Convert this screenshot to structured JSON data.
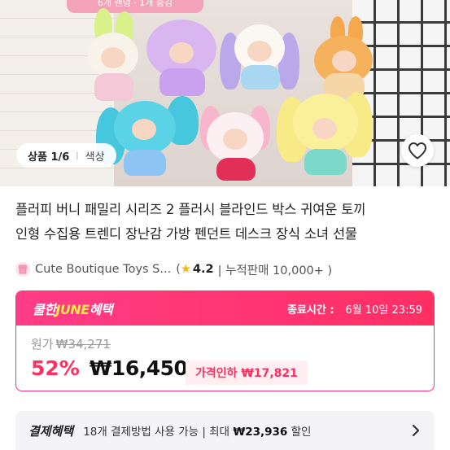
{
  "hero": {
    "banner_text": "6개 랜덤 · 1개 숨김",
    "image_counter": "상품 1/6",
    "option_tag": "색상",
    "favorite_icon": "heart-icon"
  },
  "product": {
    "title_line1": "플러피 버니 패밀리 시리즈 2 플러시 블라인드 박스 귀여운 토끼",
    "title_line2": "인형 수집용 트렌디 장난감 가방 펜던트 데스크 장식 소녀 선물"
  },
  "store": {
    "name": "Cute Boutique Toys S...",
    "open_paren": "(",
    "rating": "4.2",
    "sales": "| 누적판매 10,000+ )",
    "logo_icon": "store-logo-icon",
    "star_icon": "star-icon"
  },
  "promo": {
    "brand_prefix": "쿨한",
    "brand_highlight": "JUNE",
    "brand_suffix": "혜택",
    "ends_label": "종료시간 :",
    "ends_date": "6월 10일 23:59",
    "original_label": "원가",
    "original_price": "₩34,271",
    "discount": "52%",
    "price": "₩16,450",
    "price_drop": "가격인하 ₩17,821",
    "accent_color": "#ff2f63",
    "highlight_color": "#ffe94d"
  },
  "payment": {
    "label": "결제혜택",
    "count": "18",
    "desc_mid": "개 결제방법 사용 가능 | 최대 ",
    "max_amount": "₩23,936",
    "desc_end": " 할인",
    "chevron_icon": "chevron-right-icon"
  }
}
